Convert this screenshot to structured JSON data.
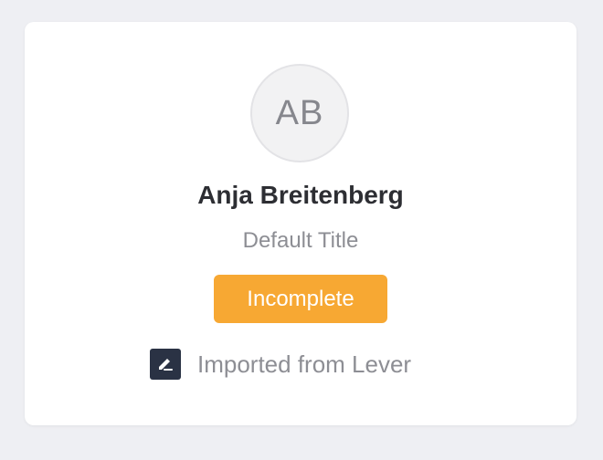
{
  "profile": {
    "initials": "AB",
    "name": "Anja Breitenberg",
    "title": "Default Title",
    "status": "Incomplete",
    "source": "Imported from Lever",
    "source_icon": "lever-icon"
  },
  "colors": {
    "background": "#eeeff3",
    "card": "#ffffff",
    "status_badge": "#f7a833",
    "source_icon_bg": "#2a3244"
  }
}
